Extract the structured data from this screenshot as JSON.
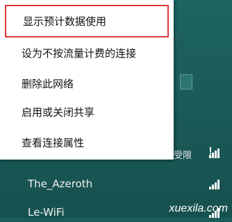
{
  "context_menu": {
    "items": [
      {
        "label": "显示预计数据使用"
      },
      {
        "label": "设为不按流量计费的连接"
      },
      {
        "label": "删除此网络"
      },
      {
        "label": "启用或关闭共享"
      },
      {
        "label": "查看连接属性"
      }
    ],
    "highlighted_index": 0
  },
  "networks": [
    {
      "name": "",
      "status": "受限",
      "icon": "wifi-signal-limited-icon"
    },
    {
      "name": "The_Azeroth",
      "icon": "wifi-signal-icon"
    },
    {
      "name": "Le-WiFi",
      "icon": "wifi-signal-icon"
    }
  ],
  "watermark": "xuexila.com",
  "colors": {
    "background": "#1b5c5a",
    "highlight_border": "#e0353a",
    "menu_bg": "#ffffff"
  }
}
